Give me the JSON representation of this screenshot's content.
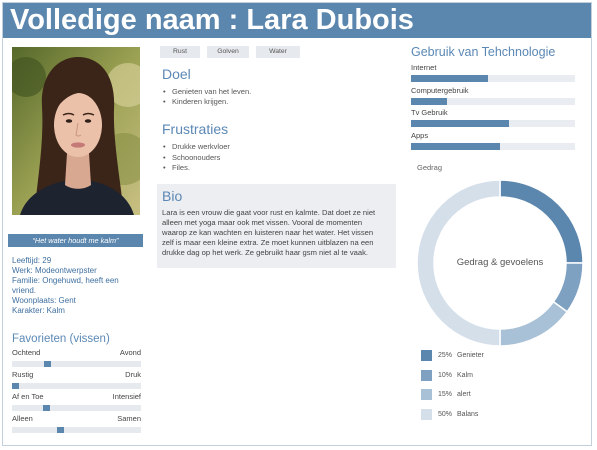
{
  "theme": {
    "accent": "#5b86ad",
    "heading": "#5b88b5",
    "info_text": "#3f6f9f"
  },
  "header": {
    "title": "Volledige naam : Lara Dubois"
  },
  "profile": {
    "quote": "“Het water houdt me kalm”",
    "info": [
      "Leeftijd: 29",
      "Werk: Modeontwerpster",
      "Familie: Ongehuwd, heeft een vriend.",
      "Woonplaats: Gent",
      "Karakter: Kalm"
    ]
  },
  "favorites": {
    "title": "Favorieten (vissen)",
    "sliders": [
      {
        "left": "Ochtend",
        "right": "Avond",
        "level": 0.26
      },
      {
        "left": "Rustig",
        "right": "Druk",
        "level": 0.0
      },
      {
        "left": "Af en Toe",
        "right": "Intensief",
        "level": 0.25
      },
      {
        "left": "Alleen",
        "right": "Samen",
        "level": 0.37
      }
    ]
  },
  "tags": [
    "Rust",
    "Golven",
    "Water"
  ],
  "doel": {
    "title": "Doel",
    "items": [
      "Genieten van het leven.",
      "Kinderen krijgen."
    ]
  },
  "frustraties": {
    "title": "Frustraties",
    "items": [
      "Drukke werkvloer",
      "Schoonouders",
      "Files."
    ]
  },
  "bio": {
    "title": "Bio",
    "lines": [
      "Lara is een vrouw die gaat voor rust en kalmte. Dat doet ze niet",
      "alleen met yoga maar ook met vissen. Vooral de momenten",
      "waarop ze kan wachten en luisteren naar het water. Het vissen",
      "zelf is maar een kleine extra. Ze moet kunnen uitblazen na een",
      "drukke dag op het werk. Ze gebruikt haar gsm niet al te vaak."
    ]
  },
  "technology": {
    "title": "Gebruik van Tehchnologie",
    "items": [
      {
        "label": "Internet",
        "value": 0.47
      },
      {
        "label": "Computergebruik",
        "value": 0.22
      },
      {
        "label": "Tv Gebruik",
        "value": 0.6
      },
      {
        "label": "Apps",
        "value": 0.54
      }
    ]
  },
  "chart_data": {
    "type": "pie",
    "donut": true,
    "title": "Gedrag",
    "center_label": "Gedrag & gevoelens",
    "categories": [
      "Genieter",
      "Kalm",
      "alert",
      "Balans"
    ],
    "values": [
      25,
      10,
      15,
      50
    ],
    "value_labels": [
      "25%",
      "10%",
      "15%",
      "50%"
    ],
    "colors": [
      "#5b86ad",
      "#7ea1c2",
      "#a8c1d7",
      "#d4dfea"
    ],
    "legend": "bottom"
  }
}
